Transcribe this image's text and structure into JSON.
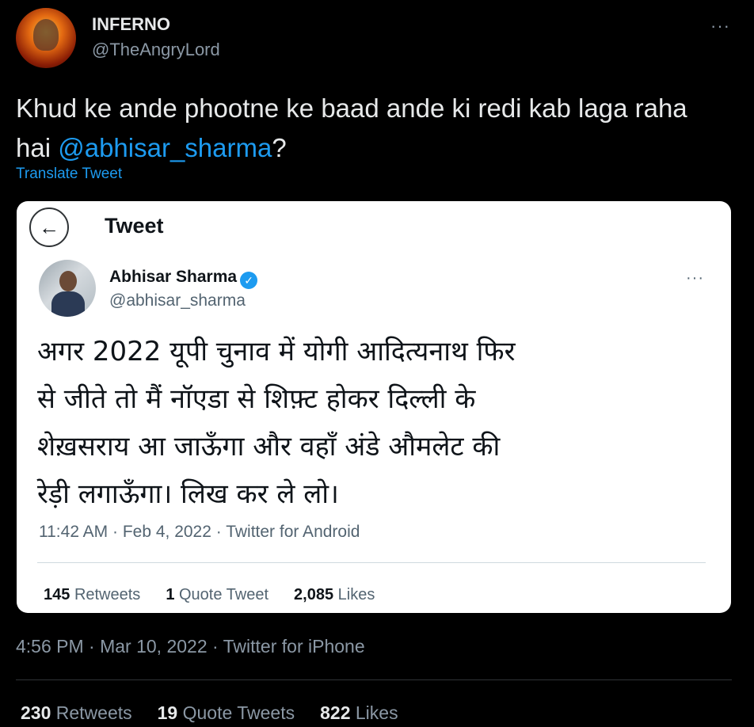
{
  "author": {
    "name": "INFERNO",
    "handle": "@TheAngryLord"
  },
  "tweet": {
    "text_before": "Khud ke ande phootne ke baad ande ki redi kab laga raha hai ",
    "mention": "@abhisar_sharma",
    "text_after": "?",
    "translate_label": "Translate Tweet",
    "more_icon": "···"
  },
  "quoted": {
    "back_icon": "←",
    "header_title": "Tweet",
    "name": "Abhisar Sharma",
    "verified_icon": "✓",
    "handle": "@abhisar_sharma",
    "more_icon": "···",
    "lines": [
      "अगर 2022 यूपी चुनाव में योगी आदित्यनाथ फिर",
      "से जीते तो मैं नॉएडा से शिफ़्ट होकर दिल्ली के",
      "शेख़सराय आ जाऊँगा और वहाँ अंडे औमलेट की",
      "रेड़ी लगाऊँगा। लिख कर ले लो।"
    ],
    "meta": "11:42 AM · Feb 4, 2022 · Twitter for Android",
    "stats": {
      "retweets_count": "145",
      "retweets_label": "Retweets",
      "quotes_count": "1",
      "quotes_label": "Quote Tweet",
      "likes_count": "2,085",
      "likes_label": "Likes"
    }
  },
  "meta": "4:56 PM · Mar 10, 2022 · Twitter for iPhone",
  "stats": {
    "retweets_count": "230",
    "retweets_label": "Retweets",
    "quotes_count": "19",
    "quotes_label": "Quote Tweets",
    "likes_count": "822",
    "likes_label": "Likes"
  },
  "colors": {
    "background": "#000000",
    "link": "#1d9bf0",
    "muted": "#8b98a5"
  }
}
